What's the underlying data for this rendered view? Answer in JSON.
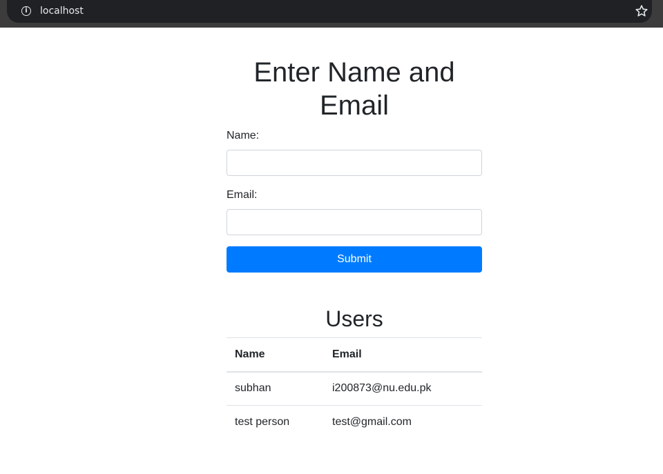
{
  "browser": {
    "url": "localhost",
    "info_icon": "info-icon",
    "bookmark_icon": "star-icon"
  },
  "form": {
    "title": "Enter Name and Email",
    "name_label": "Name:",
    "name_value": "",
    "email_label": "Email:",
    "email_value": "",
    "submit_label": "Submit"
  },
  "users": {
    "title": "Users",
    "columns": [
      "Name",
      "Email"
    ],
    "rows": [
      {
        "name": "subhan",
        "email": "i200873@nu.edu.pk"
      },
      {
        "name": "test person",
        "email": "test@gmail.com"
      }
    ]
  },
  "colors": {
    "primary": "#007bff",
    "text": "#212529",
    "border": "#dee2e6"
  }
}
